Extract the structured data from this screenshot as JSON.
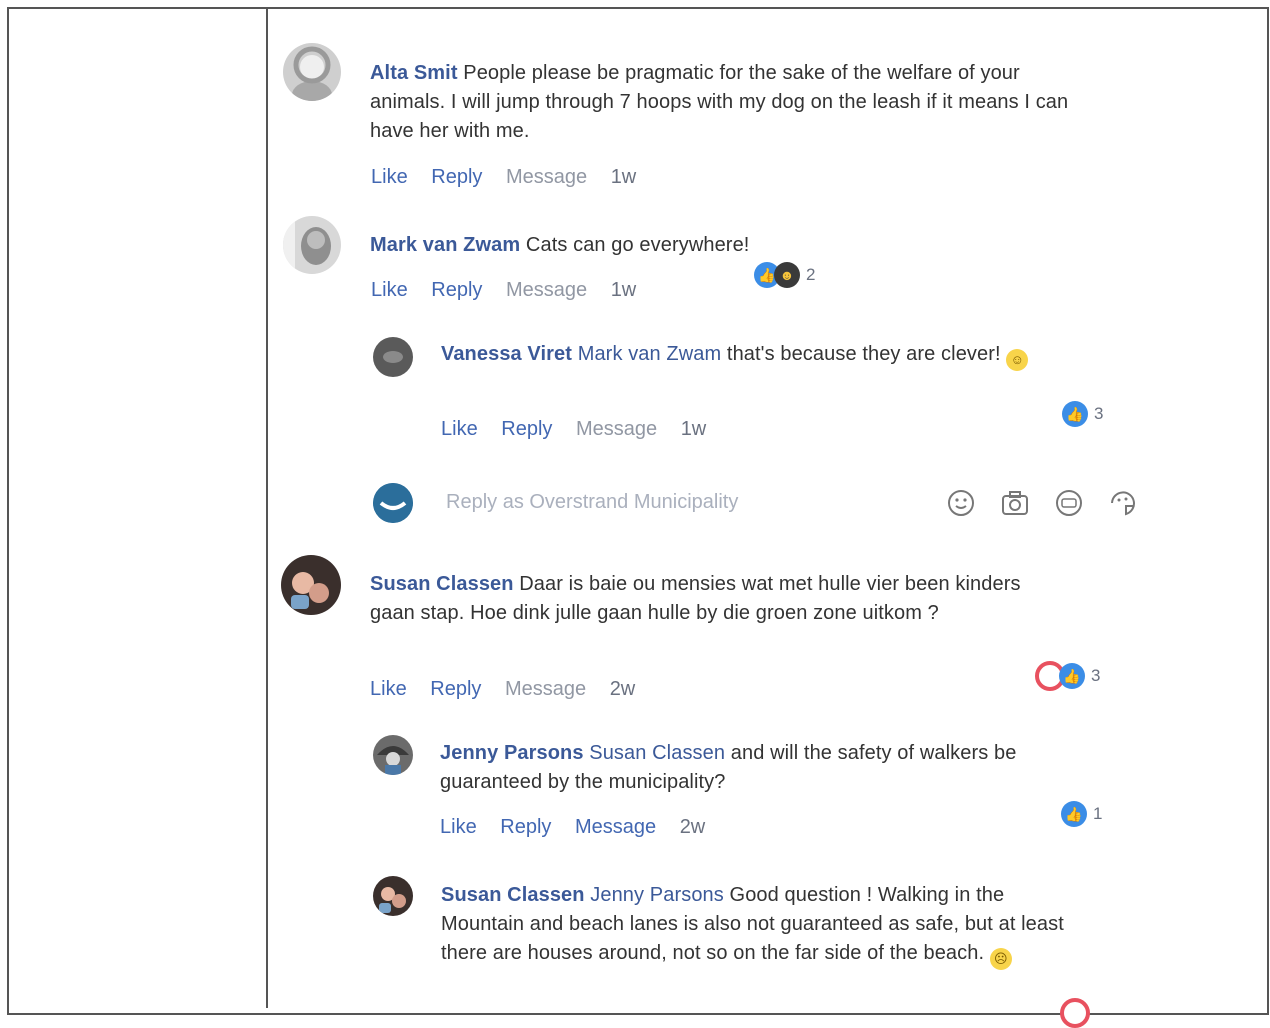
{
  "comments": [
    {
      "name": "Alta Smit",
      "text": "People please be pragmatic for the sake of the welfare of your animals. I will jump through 7 hoops with my dog on the leash if it means I can have her with me.",
      "actions": {
        "like": "Like",
        "reply": "Reply",
        "message": "Message",
        "time": "1w"
      }
    },
    {
      "name": "Mark van Zwam",
      "text": "Cats can go everywhere!",
      "actions": {
        "like": "Like",
        "reply": "Reply",
        "message": "Message",
        "time": "1w"
      },
      "reactions": {
        "count": "2"
      }
    },
    {
      "name": "Vanessa Viret",
      "mention": "Mark van Zwam",
      "text": "that's because they are clever!",
      "actions": {
        "like": "Like",
        "reply": "Reply",
        "message": "Message",
        "time": "1w"
      },
      "reactions": {
        "count": "3"
      }
    },
    {
      "name": "Susan Classen",
      "text": "Daar is baie ou mensies wat met hulle vier been kinders gaan stap. Hoe dink julle gaan hulle by die groen zone uitkom ?",
      "actions": {
        "like": "Like",
        "reply": "Reply",
        "message": "Message",
        "time": "2w"
      },
      "reactions": {
        "count": "3"
      }
    },
    {
      "name": "Jenny Parsons",
      "mention": "Susan Classen",
      "text": "and will the safety of walkers be guaranteed by the municipality?",
      "actions": {
        "like": "Like",
        "reply": "Reply",
        "message": "Message",
        "time": "2w"
      },
      "reactions": {
        "count": "1"
      }
    },
    {
      "name": "Susan Classen",
      "mention": "Jenny Parsons",
      "text": "Good question ! Walking in the Mountain and beach lanes is also not guaranteed as safe, but at least there are houses around, not so on the far side of the beach."
    }
  ],
  "reply_box": {
    "placeholder": "Reply as Overstrand Municipality"
  },
  "icons": [
    "smiley-icon",
    "camera-icon",
    "gif-icon",
    "sticker-icon",
    "like-reaction-icon",
    "haha-reaction-icon",
    "love-reaction-icon"
  ],
  "colors": {
    "name": "#3b5998",
    "link": "#4267b2",
    "like": "#3b8de6",
    "love": "#e8515f"
  }
}
